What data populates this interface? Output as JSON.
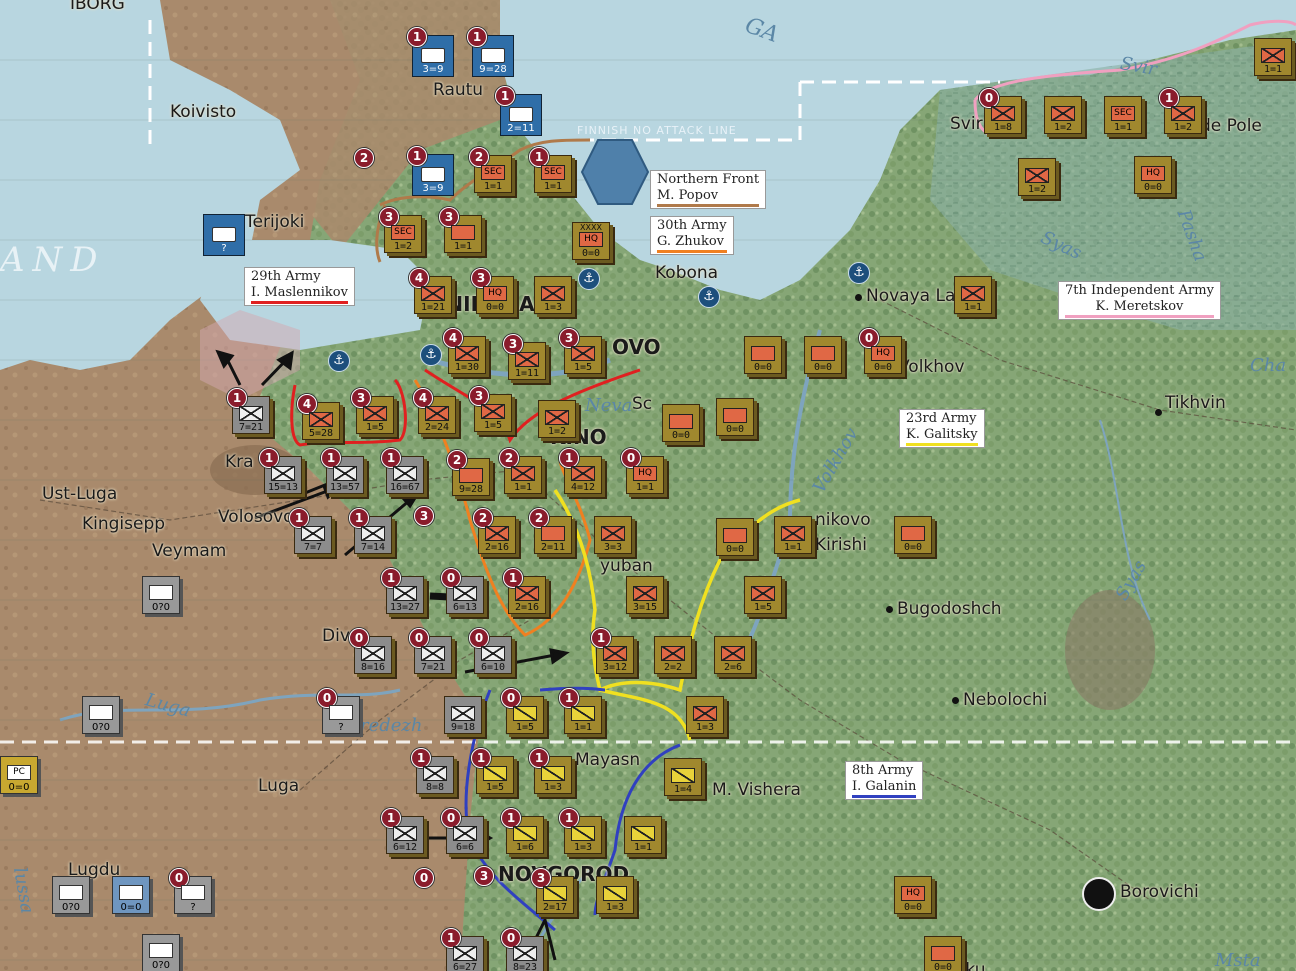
{
  "map_labels": {
    "top_cut_label": "IBORG",
    "koivisto": "Koivisto",
    "terijoki": "Terijoki",
    "rautu": "Rautu",
    "finnish_line": "FINNISH NO ATTACK LINE",
    "finland": "AND",
    "kobona": "Kobona",
    "novaya_ladoga": "Novaya Ladoga",
    "svir": "Svir",
    "lodeynoe_pole": "de Pole",
    "leningrad": "LENINGRAD",
    "kolpino_frag": "OVO",
    "volkhov": "Volkhov",
    "tikhvin": "Tikhvin",
    "ust_luga": "Ust-Luga",
    "kingisepp": "Kingisepp",
    "volosovo": "Volosovo",
    "veymam": "Veymam",
    "krasnogvardeysk": "Kra",
    "pushkin_frag": "KINO",
    "kirishi": "Kirishi",
    "kirishi_frag": "nikovo",
    "bugodoshch": "Bugodoshch",
    "nebolochi": "Nebolochi",
    "luga": "Luga",
    "luga_river": "Luga",
    "lugdu": "Lugdu",
    "mayasna": "Mayasn",
    "m_vishera": "M. Vishera",
    "novgorod": "NOVGOROD",
    "borovichi": "Borovichi",
    "syas_river": "Syas",
    "syas_river2": "Syas",
    "pasha": "Pasha",
    "cha": "Cha",
    "volkhov_river": "Volkhov",
    "neva": "Neva",
    "lake_ladoga_frag": "GA",
    "oredezh": "redezh",
    "divenskaya": "Div",
    "oku": "oku",
    "lyuban": "yuban",
    "siverskiy": "S",
    "shlisselburg": "Sc",
    "msta": "Msta",
    "luzha": "lussa"
  },
  "notes": [
    {
      "title": "Northern Front",
      "commander": "M. Popov",
      "color": "#b07a4a"
    },
    {
      "title": "30th Army",
      "commander": "G. Zhukov",
      "color": "#f08020"
    },
    {
      "title": "29th Army",
      "commander": "I. Maslennikov",
      "color": "#e02020"
    },
    {
      "title": "7th Independent Army",
      "commander": "K. Meretskov",
      "color": "#f0a0c0"
    },
    {
      "title": "23rd Army",
      "commander": "K. Galitsky",
      "color": "#f0e020"
    },
    {
      "title": "8th Army",
      "commander": "I. Galanin",
      "color": "#3040c0"
    }
  ],
  "units": {
    "fin": [
      {
        "badge": "1",
        "str": "3=9"
      },
      {
        "badge": "1",
        "str": "9=28"
      },
      {
        "badge": "1",
        "str": "2=11"
      },
      {
        "badge": "1",
        "str": "3=9"
      }
    ],
    "sov": [
      {
        "badge": "2",
        "type": "SEC",
        "str": "1=1"
      },
      {
        "badge": "1",
        "type": "SEC",
        "str": "1=1"
      },
      {
        "badge": "3",
        "type": "SEC",
        "str": "1=2"
      },
      {
        "badge": "3",
        "type": "",
        "str": "1=1"
      },
      {
        "badge": "",
        "type": "HQ",
        "str": "0=0",
        "size": "XXXX"
      },
      {
        "badge": "4",
        "type": "",
        "str": "1=21"
      },
      {
        "badge": "3",
        "type": "HQ",
        "str": "0=0"
      },
      {
        "badge": "",
        "type": "",
        "str": "1=3"
      },
      {
        "badge": "4",
        "type": "",
        "str": "1=30"
      },
      {
        "badge": "3",
        "type": "",
        "str": "1=11"
      },
      {
        "badge": "3",
        "type": "",
        "str": "1=5"
      },
      {
        "badge": "4",
        "type": "",
        "str": "5=28"
      },
      {
        "badge": "3",
        "type": "",
        "str": "1=5"
      },
      {
        "badge": "4",
        "type": "",
        "str": "2=24"
      },
      {
        "badge": "3",
        "type": "",
        "str": "1=5"
      },
      {
        "badge": "",
        "type": "",
        "str": "1=2"
      },
      {
        "badge": "",
        "type": "",
        "str": "0=0"
      },
      {
        "badge": "",
        "type": "",
        "str": "0=0"
      },
      {
        "badge": "2",
        "type": "",
        "str": "9=28"
      },
      {
        "badge": "2",
        "type": "",
        "str": "1=1"
      },
      {
        "badge": "1",
        "type": "",
        "str": "4=12"
      },
      {
        "badge": "0",
        "type": "HQ",
        "str": "1=1"
      },
      {
        "badge": "2",
        "type": "",
        "str": "2=16"
      },
      {
        "badge": "2",
        "type": "",
        "str": "2=11"
      },
      {
        "badge": "",
        "type": "",
        "str": "3=3"
      },
      {
        "badge": "1",
        "type": "",
        "str": "2=16"
      },
      {
        "badge": "",
        "type": "",
        "str": "3=15"
      },
      {
        "badge": "1",
        "type": "",
        "str": "3=12"
      },
      {
        "badge": "",
        "type": "",
        "str": "2=2"
      },
      {
        "badge": "",
        "type": "",
        "str": "2=6"
      },
      {
        "badge": "",
        "type": "",
        "str": "1=3"
      },
      {
        "badge": "",
        "type": "",
        "str": "0=0"
      },
      {
        "badge": "",
        "type": "",
        "str": "1=1"
      },
      {
        "badge": "",
        "type": "",
        "str": "0=0"
      },
      {
        "badge": "",
        "type": "",
        "str": "1=5"
      },
      {
        "badge": "",
        "type": "",
        "str": "0=0"
      },
      {
        "badge": "",
        "type": "",
        "str": "0=0"
      },
      {
        "badge": "0",
        "type": "HQ",
        "str": "0=0"
      },
      {
        "badge": "",
        "type": "",
        "str": "1=1"
      },
      {
        "badge": "0",
        "type": "",
        "str": "1=8"
      },
      {
        "badge": "",
        "type": "",
        "str": "1=2"
      },
      {
        "badge": "",
        "type": "SEC",
        "str": "1=1"
      },
      {
        "badge": "1",
        "type": "",
        "str": "1=2"
      },
      {
        "badge": "",
        "type": "",
        "str": "1=2"
      },
      {
        "badge": "",
        "type": "HQ",
        "str": "0=0"
      },
      {
        "badge": "",
        "type": "",
        "str": "1=1"
      },
      {
        "badge": "",
        "type": "HQ",
        "str": "0=0"
      },
      {
        "badge": "",
        "type": "",
        "str": "0=0"
      }
    ],
    "yel": [
      {
        "badge": "0",
        "str": "1=5"
      },
      {
        "badge": "1",
        "str": "1=1"
      },
      {
        "badge": "1",
        "str": "1=5"
      },
      {
        "badge": "1",
        "str": "1=3"
      },
      {
        "badge": "1",
        "str": "1=6"
      },
      {
        "badge": "1",
        "str": "1=3"
      },
      {
        "badge": "",
        "str": "1=1"
      },
      {
        "badge": "",
        "str": "1=4"
      },
      {
        "badge": "3",
        "str": "2=17"
      },
      {
        "badge": "",
        "str": "1=3"
      }
    ],
    "ger": [
      {
        "badge": "1",
        "str": "7=21"
      },
      {
        "badge": "1",
        "str": "15=13"
      },
      {
        "badge": "1",
        "str": "13=57"
      },
      {
        "badge": "1",
        "str": "16=67"
      },
      {
        "badge": "1",
        "str": "7=7"
      },
      {
        "badge": "1",
        "str": "7=14"
      },
      {
        "badge": "1",
        "str": "13=27"
      },
      {
        "badge": "0",
        "str": "6=13"
      },
      {
        "badge": "0",
        "str": "8=16"
      },
      {
        "badge": "0",
        "str": "7=21"
      },
      {
        "badge": "0",
        "str": "6=10"
      },
      {
        "badge": "",
        "str": "9=18"
      },
      {
        "badge": "1",
        "str": "8=8"
      },
      {
        "badge": "1",
        "str": "6=12"
      },
      {
        "badge": "0",
        "str": "6=6"
      },
      {
        "badge": "1",
        "str": "6=27"
      },
      {
        "badge": "0",
        "str": "8=23"
      }
    ],
    "gray": [
      {
        "str": "0?0"
      },
      {
        "str": "0?0"
      },
      {
        "str": "?"
      },
      {
        "str": "0=0"
      },
      {
        "str": "0?0"
      },
      {
        "str": "?"
      },
      {
        "str": "0?0"
      },
      {
        "str": "?"
      }
    ],
    "pc": {
      "type": "PC",
      "str": "0=0"
    }
  }
}
